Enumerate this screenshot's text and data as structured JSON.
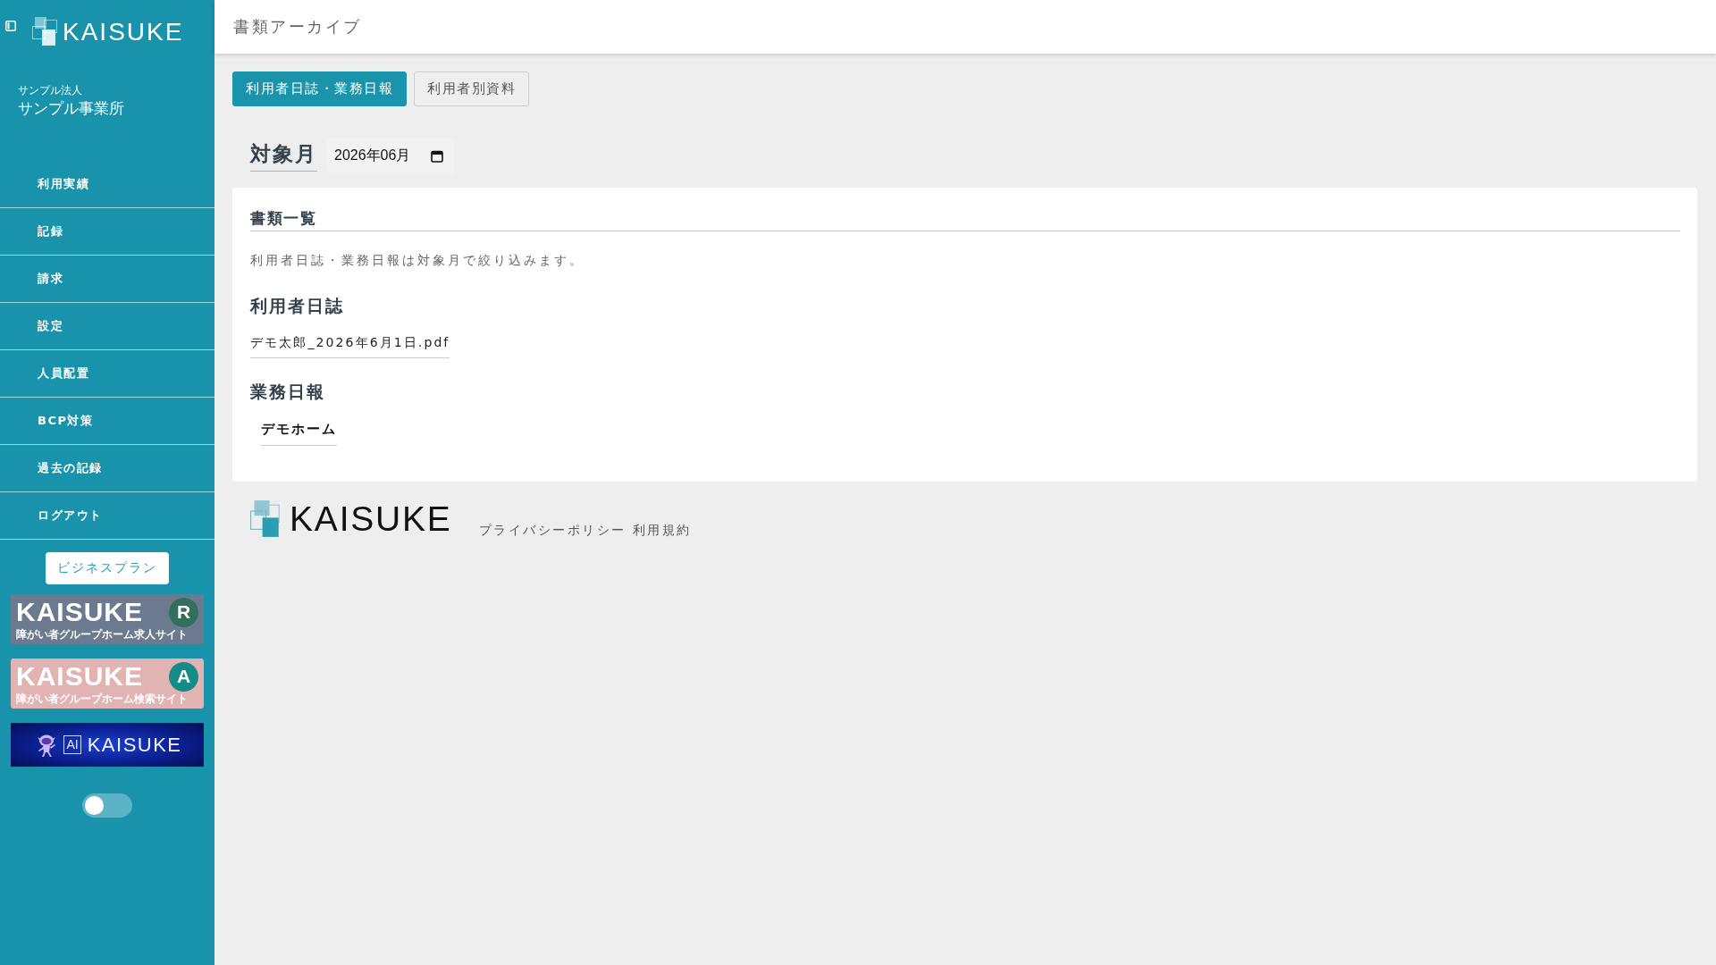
{
  "sidebar": {
    "logo": "KAISUKE",
    "organization": "サンプル法人",
    "office": "サンプル事業所",
    "nav_items": [
      "利用実績",
      "記録",
      "請求",
      "設定",
      "人員配置",
      "BCP対策",
      "過去の記録",
      "ログアウト"
    ],
    "plan": "ビジネスプラン",
    "banners": [
      {
        "kind": "recruit",
        "title": "KAISUKE",
        "subtitle": "障がい者グループホーム求人サイト",
        "badge": "R"
      },
      {
        "kind": "search",
        "title": "KAISUKE",
        "subtitle": "障がい者グループホーム検索サイト",
        "badge": "A"
      },
      {
        "kind": "ai",
        "label": "AI",
        "title": "KAISUKE"
      }
    ],
    "toggle": {
      "on": false
    }
  },
  "header": {
    "title": "書類アーカイブ"
  },
  "tabs": [
    {
      "label": "利用者日誌・業務日報",
      "selected": true
    },
    {
      "label": "利用者別資料",
      "selected": false
    }
  ],
  "month_filter": {
    "label": "対象月",
    "value": "2026年06月"
  },
  "documents": {
    "title": "書類一覧",
    "note": "利用者日誌・業務日報は対象月で絞り込みます。",
    "sections": [
      {
        "kind": "files",
        "title": "利用者日誌",
        "items": [
          "デモ太郎_2026年6月1日.pdf"
        ]
      },
      {
        "kind": "homes",
        "title": "業務日報",
        "items": [
          "デモホーム"
        ]
      }
    ]
  },
  "footer": {
    "logo": "KAISUKE",
    "links": [
      "プライバシーポリシー",
      "利用規約"
    ]
  }
}
